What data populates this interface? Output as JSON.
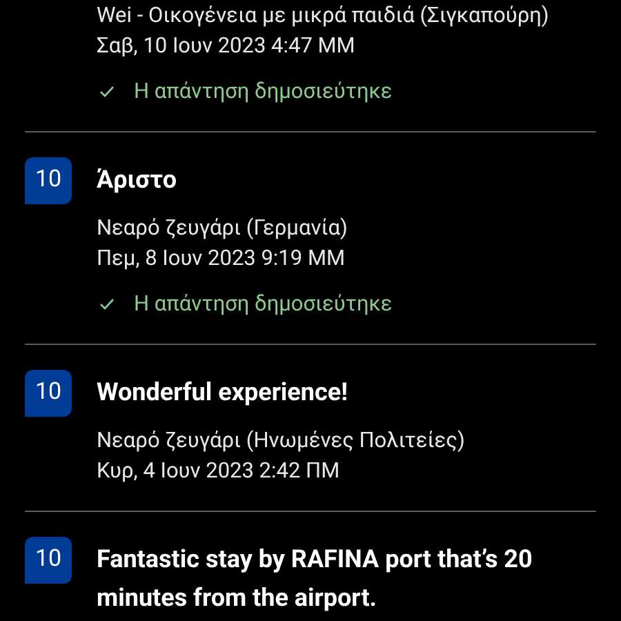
{
  "reviews": [
    {
      "reviewer": "Wei - Οικογένεια με μικρά παιδιά (Σιγκαπούρη)",
      "date": "Σαβ, 10 Ιουν 2023 4:47 ΜΜ",
      "replied": true,
      "reply_status": "Η απάντηση δημοσιεύτηκε"
    },
    {
      "score": "10",
      "title": "Άριστο",
      "reviewer": "Νεαρό ζευγάρι (Γερμανία)",
      "date": "Πεμ, 8 Ιουν 2023 9:19 ΜΜ",
      "replied": true,
      "reply_status": "Η απάντηση δημοσιεύτηκε"
    },
    {
      "score": "10",
      "title": "Wonderful experience!",
      "reviewer": "Νεαρό ζευγάρι (Ηνωμένες Πολιτείες)",
      "date": "Κυρ, 4 Ιουν 2023 2:42 ΠΜ",
      "replied": false
    },
    {
      "score": "10",
      "title": "Fantastic stay by RAFINA port that’s 20 minutes from the airport."
    }
  ]
}
